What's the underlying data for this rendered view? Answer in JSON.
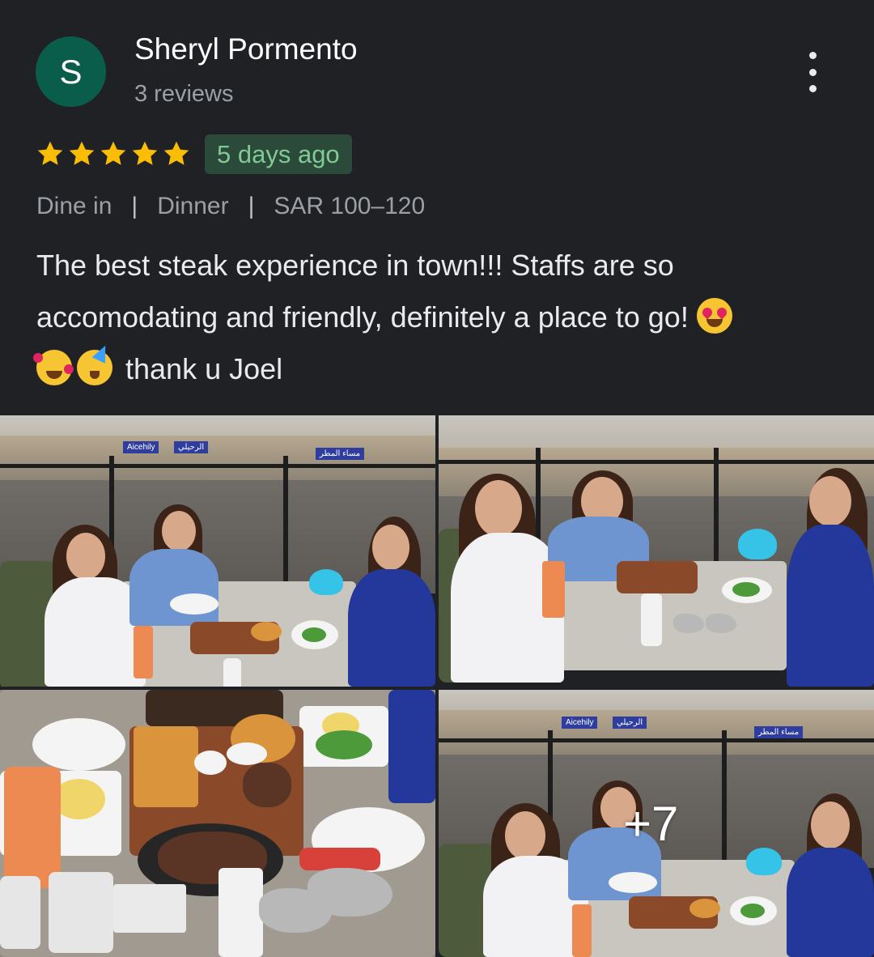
{
  "reviewer": {
    "initial": "S",
    "name": "Sheryl Pormento",
    "review_count": "3 reviews",
    "avatar_color": "#0b5d4b"
  },
  "menu_icon": "more-vert-icon",
  "rating": {
    "stars": 5,
    "max": 5,
    "star_color": "#fbbc04"
  },
  "time_ago": "5 days ago",
  "meta": {
    "service": "Dine in",
    "meal": "Dinner",
    "price": "SAR 100–120"
  },
  "review": {
    "line1": "The best steak experience in town!!! Staffs are so",
    "line2": "accomodating and friendly, definitely a place to go!",
    "line3": "thank u Joel",
    "emojis": [
      "heart-eyes-emoji",
      "smiling-hearts-emoji",
      "partying-face-emoji"
    ]
  },
  "photos": {
    "more_count": "+7",
    "signs": {
      "shop1": "Aicehily",
      "shop2": "الرحيلي",
      "shop3": "مساء المطر"
    }
  }
}
